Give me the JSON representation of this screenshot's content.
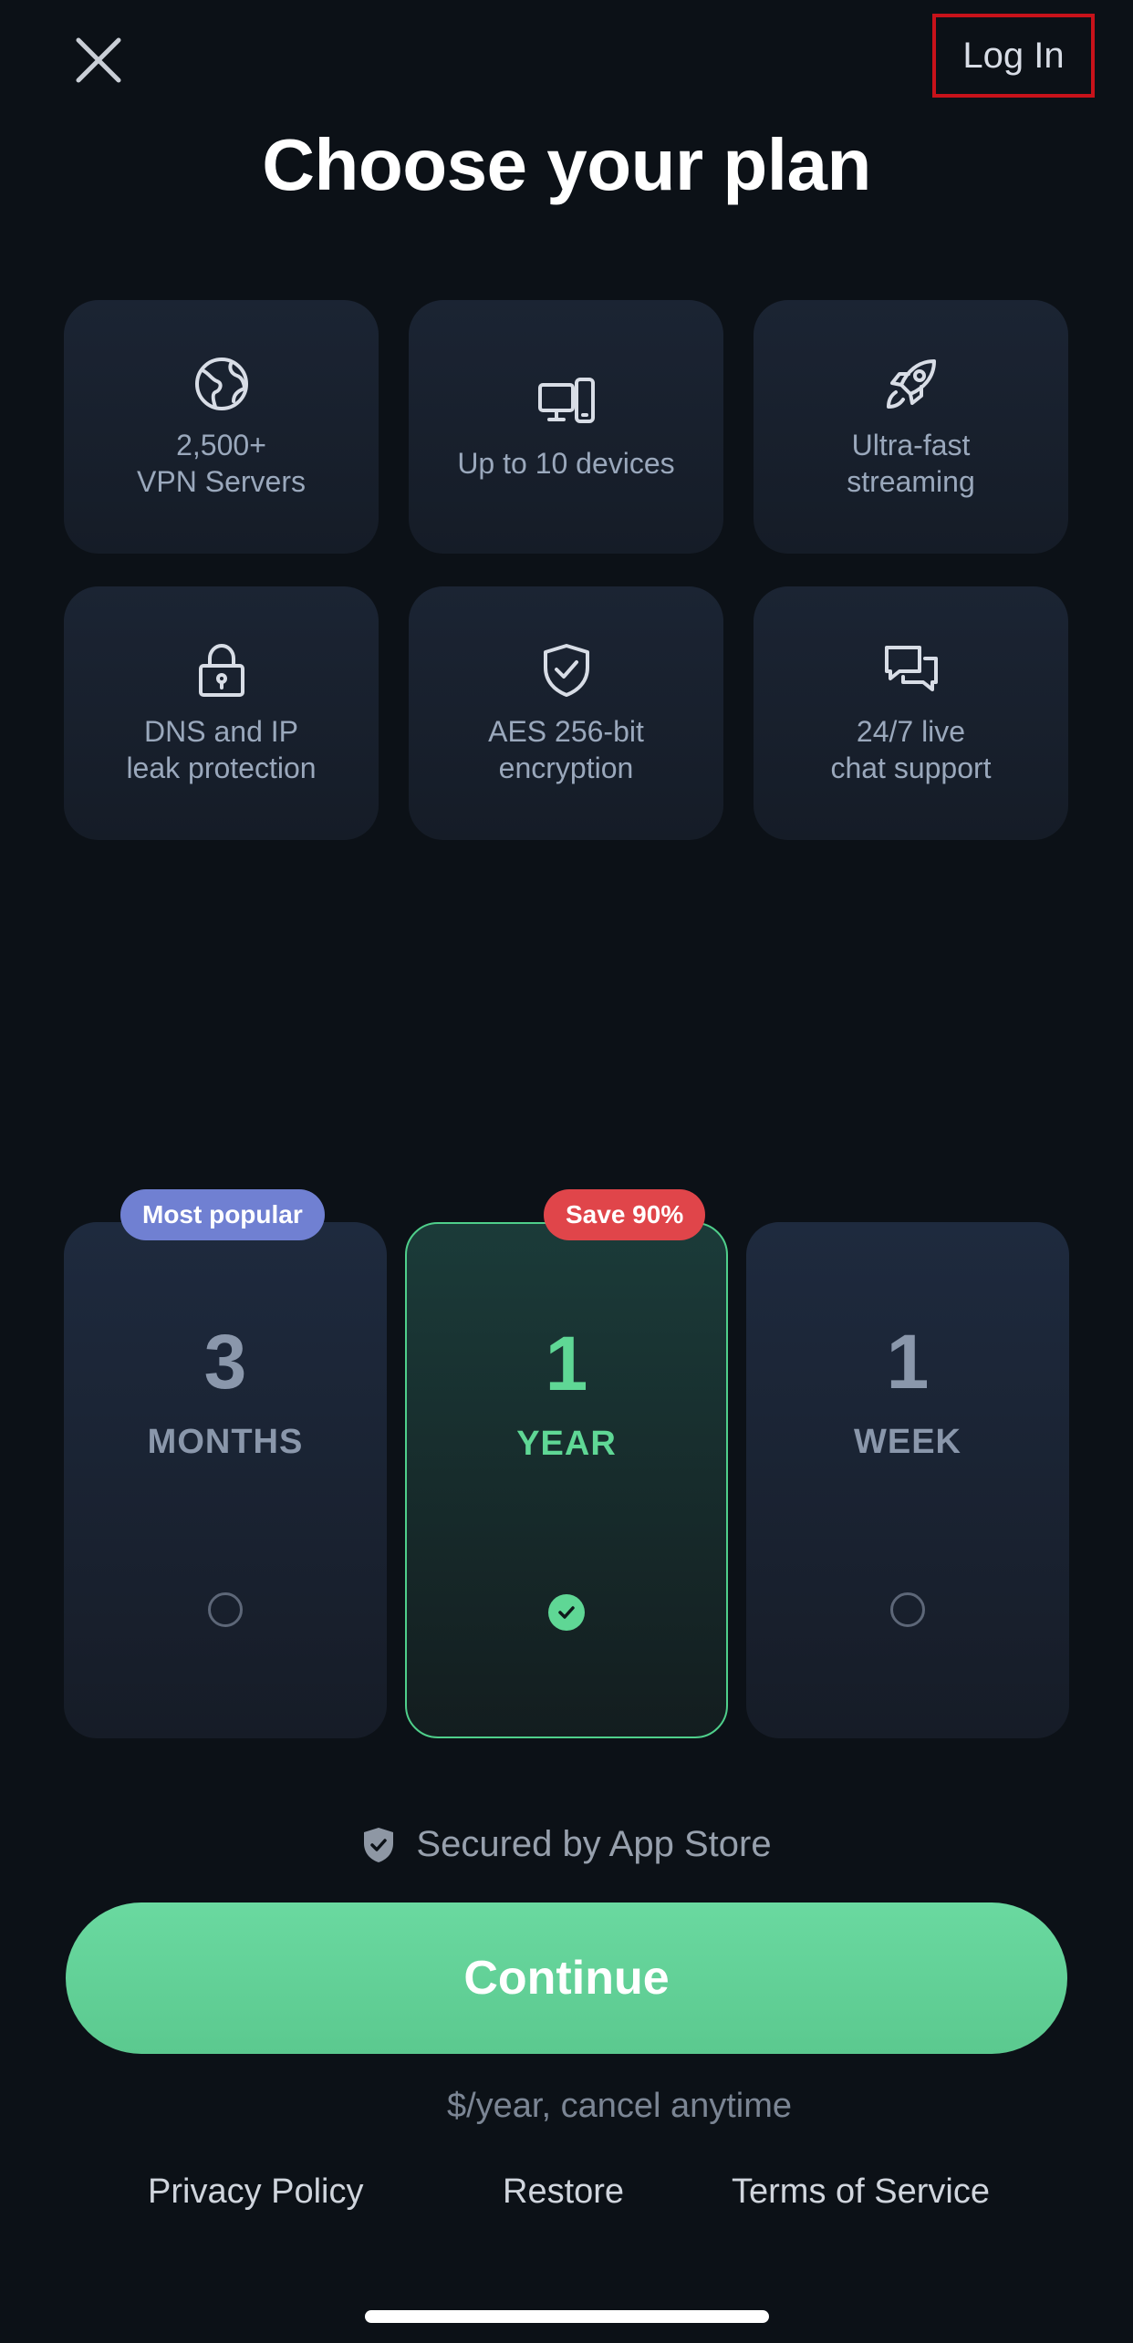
{
  "header": {
    "login_label": "Log In",
    "title": "Choose your plan"
  },
  "features": [
    {
      "icon": "globe-icon",
      "label": "2,500+\nVPN Servers"
    },
    {
      "icon": "devices-icon",
      "label": "Up to 10 devices"
    },
    {
      "icon": "rocket-icon",
      "label": "Ultra-fast\nstreaming"
    },
    {
      "icon": "lock-icon",
      "label": "DNS and IP\nleak protection"
    },
    {
      "icon": "shield-check-icon",
      "label": "AES 256-bit\nencryption"
    },
    {
      "icon": "chat-icon",
      "label": "24/7 live\nchat support"
    }
  ],
  "plans": [
    {
      "number": "3",
      "unit": "MONTHS",
      "badge": "Most popular",
      "selected": false
    },
    {
      "number": "1",
      "unit": "YEAR",
      "badge": "Save 90%",
      "selected": true
    },
    {
      "number": "1",
      "unit": "WEEK",
      "badge": "",
      "selected": false
    }
  ],
  "secured_label": "Secured by App Store",
  "continue_label": "Continue",
  "price_note": "$/year, cancel anytime",
  "footer": {
    "privacy": "Privacy Policy",
    "restore": "Restore",
    "terms": "Terms of Service"
  },
  "colors": {
    "background": "#0c1117",
    "accent": "#5fd795",
    "badge_popular": "#7080d2",
    "badge_save": "#e0454a"
  }
}
